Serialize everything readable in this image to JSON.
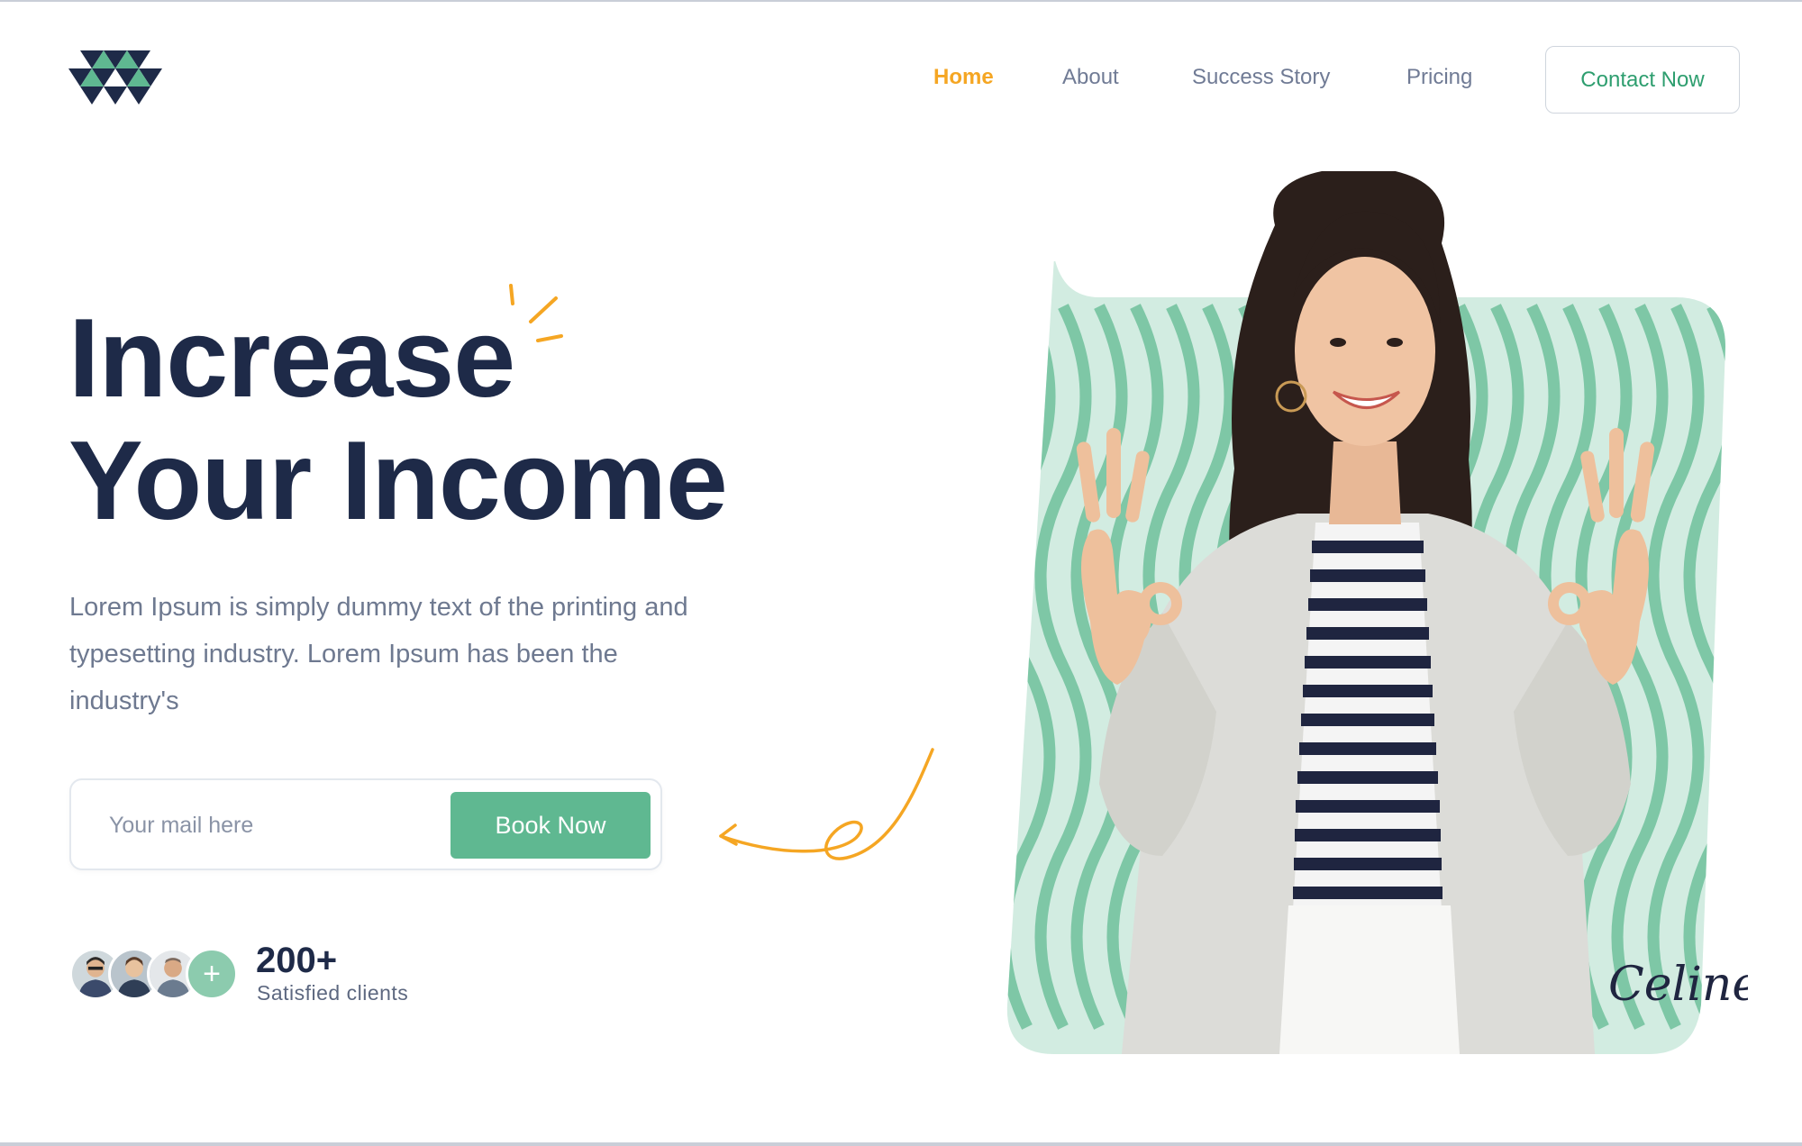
{
  "nav": {
    "items": [
      {
        "label": "Home",
        "active": true
      },
      {
        "label": "About",
        "active": false
      },
      {
        "label": "Success Story",
        "active": false
      },
      {
        "label": "Pricing",
        "active": false
      }
    ],
    "contact_label": "Contact Now"
  },
  "hero": {
    "headline_line1": "Increase",
    "headline_line2": "Your Income",
    "description": "Lorem Ipsum is simply dummy text of the printing and typesetting industry. Lorem Ipsum has been the industry's",
    "email_placeholder": "Your mail here",
    "email_value": "",
    "book_label": "Book Now",
    "signature": "Celine"
  },
  "clients": {
    "count": "200+",
    "label": "Satisfied clients",
    "plus_icon": "+"
  },
  "colors": {
    "accent_green": "#5fb891",
    "accent_orange": "#f5a623",
    "heading_navy": "#1e2a48",
    "logo_navy": "#1e2a48",
    "logo_green": "#5fb891",
    "pattern_light": "#d2ece1",
    "pattern_dark": "#7ec7a6"
  },
  "icons": {
    "logo": "triangle-logo-icon",
    "sparkle": "sparkle-icon",
    "arrow": "curly-arrow-icon",
    "plus": "plus-icon"
  }
}
